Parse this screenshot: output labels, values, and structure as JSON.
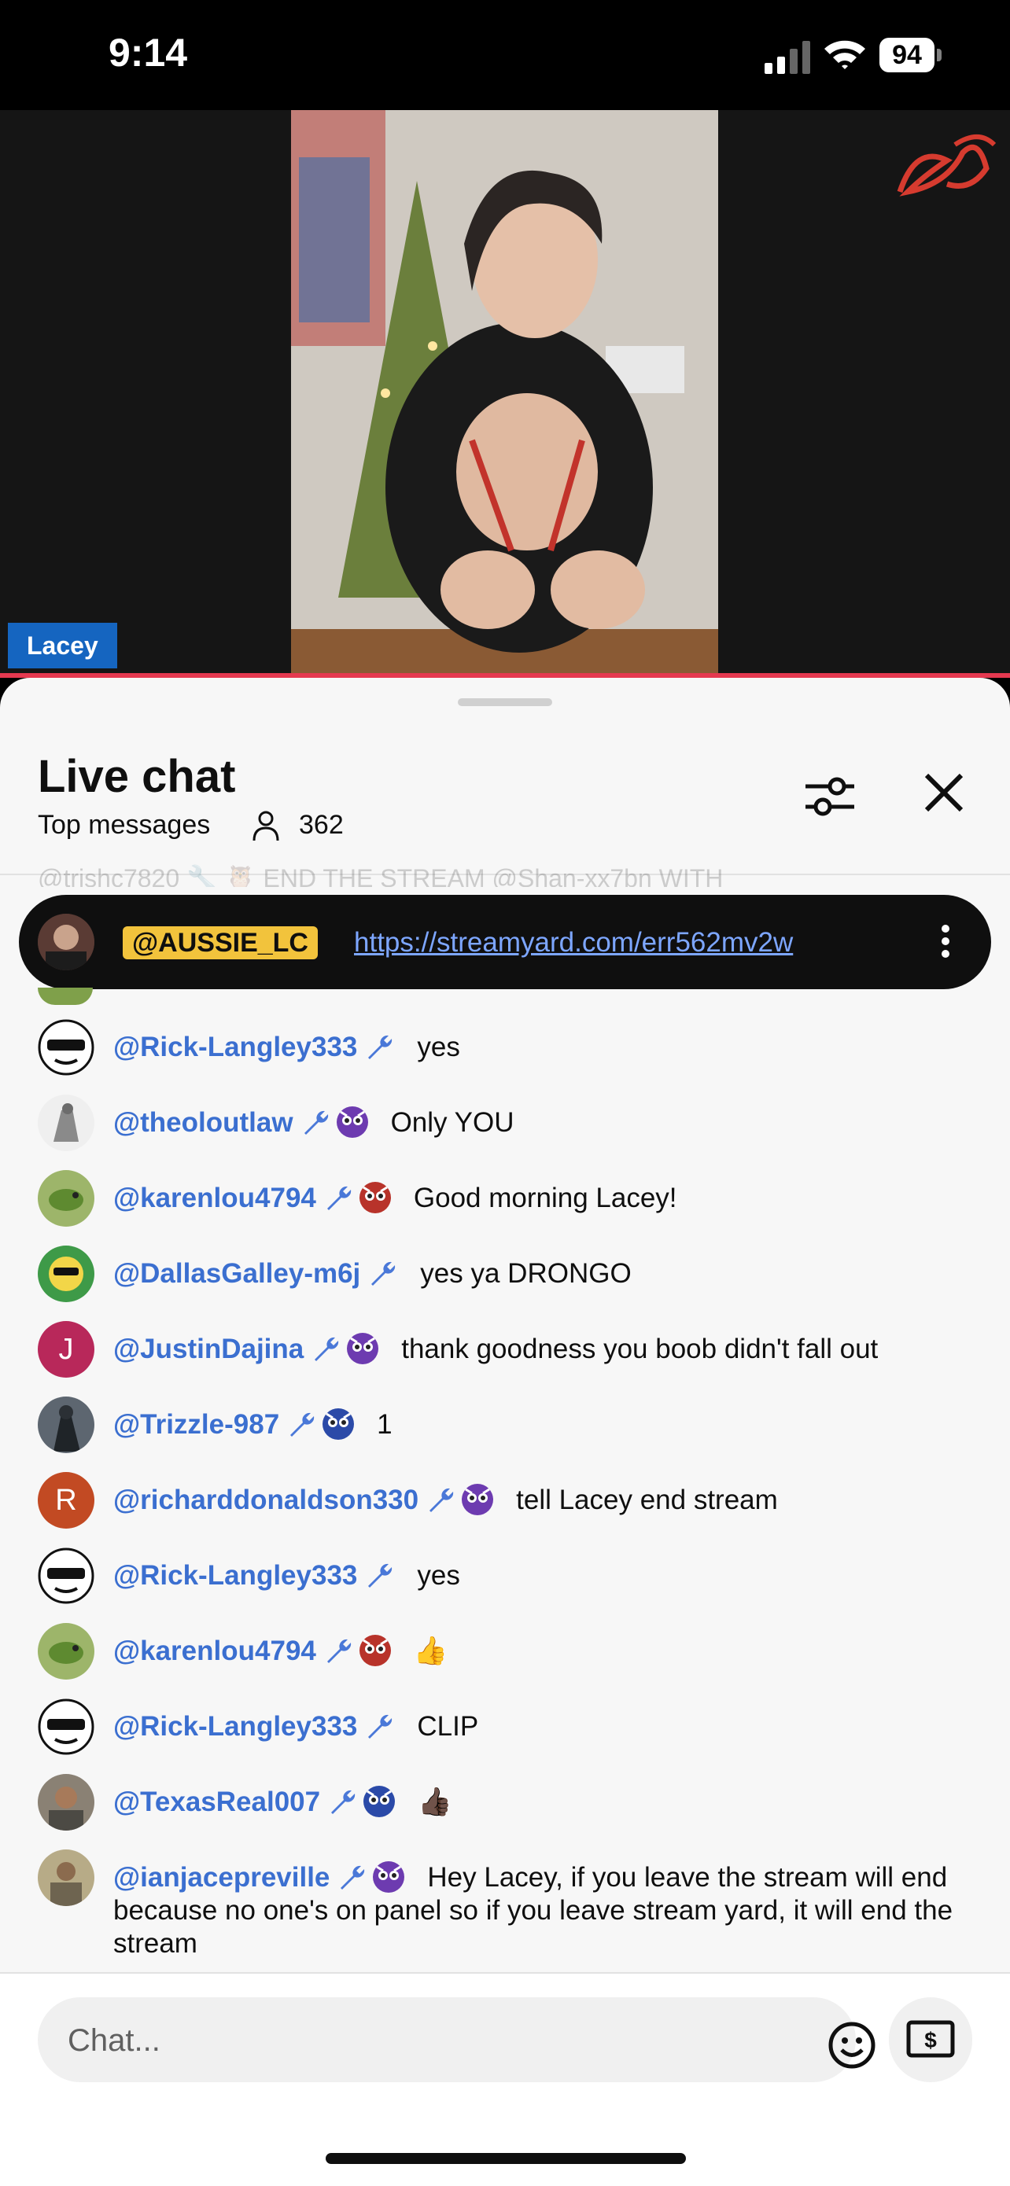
{
  "status_bar": {
    "time": "9:14",
    "battery": "94"
  },
  "video": {
    "name_tag": "Lacey"
  },
  "chat_header": {
    "title": "Live chat",
    "mode": "Top messages",
    "viewers": "362"
  },
  "ghost_line": "@trishc7820 🔧 🦉  END THE STREAM @Shan-xx7bn WITH",
  "pinned": {
    "author": "@AUSSIE_LC",
    "link": "https://streamyard.com/err562mv2w"
  },
  "messages": [
    {
      "author": "@Rick-Langley333",
      "text": "yes",
      "badge": false
    },
    {
      "author": "@theoloutlaw",
      "text": "Only YOU",
      "badge": true
    },
    {
      "author": "@karenlou4794",
      "text": "Good morning Lacey!",
      "badge": true
    },
    {
      "author": "@DallasGalley-m6j",
      "text": "yes ya DRONGO",
      "badge": false
    },
    {
      "author": "@JustinDajina",
      "text": "thank goodness you boob didn't fall out",
      "badge": true,
      "initial": "J"
    },
    {
      "author": "@Trizzle-987",
      "text": "1",
      "badge": true
    },
    {
      "author": "@richarddonaldson330",
      "text": "tell Lacey end stream",
      "badge": true,
      "initial": "R"
    },
    {
      "author": "@Rick-Langley333",
      "text": "yes",
      "badge": false
    },
    {
      "author": "@karenlou4794",
      "text": "👍",
      "badge": true
    },
    {
      "author": "@Rick-Langley333",
      "text": "CLIP",
      "badge": false
    },
    {
      "author": "@TexasReal007",
      "text": "👍🏿",
      "badge": true
    },
    {
      "author": "@ianjacepreville",
      "text": "Hey Lacey, if you leave the stream will end because no one's on panel so if you leave stream yard, it will end the stream",
      "badge": true
    }
  ],
  "input": {
    "placeholder": "Chat..."
  },
  "colors": {
    "author": "#3b6fd0",
    "pinned_badge": "#f2c33c",
    "progress": "#e53950"
  }
}
